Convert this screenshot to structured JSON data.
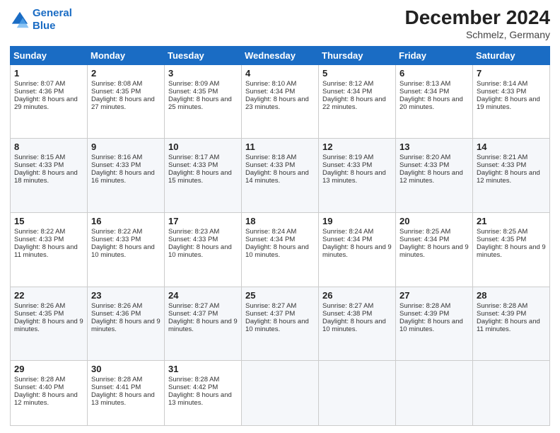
{
  "header": {
    "logo_line1": "General",
    "logo_line2": "Blue",
    "month": "December 2024",
    "location": "Schmelz, Germany"
  },
  "days_of_week": [
    "Sunday",
    "Monday",
    "Tuesday",
    "Wednesday",
    "Thursday",
    "Friday",
    "Saturday"
  ],
  "weeks": [
    [
      {
        "day": "1",
        "sunrise": "Sunrise: 8:07 AM",
        "sunset": "Sunset: 4:36 PM",
        "daylight": "Daylight: 8 hours and 29 minutes."
      },
      {
        "day": "2",
        "sunrise": "Sunrise: 8:08 AM",
        "sunset": "Sunset: 4:35 PM",
        "daylight": "Daylight: 8 hours and 27 minutes."
      },
      {
        "day": "3",
        "sunrise": "Sunrise: 8:09 AM",
        "sunset": "Sunset: 4:35 PM",
        "daylight": "Daylight: 8 hours and 25 minutes."
      },
      {
        "day": "4",
        "sunrise": "Sunrise: 8:10 AM",
        "sunset": "Sunset: 4:34 PM",
        "daylight": "Daylight: 8 hours and 23 minutes."
      },
      {
        "day": "5",
        "sunrise": "Sunrise: 8:12 AM",
        "sunset": "Sunset: 4:34 PM",
        "daylight": "Daylight: 8 hours and 22 minutes."
      },
      {
        "day": "6",
        "sunrise": "Sunrise: 8:13 AM",
        "sunset": "Sunset: 4:34 PM",
        "daylight": "Daylight: 8 hours and 20 minutes."
      },
      {
        "day": "7",
        "sunrise": "Sunrise: 8:14 AM",
        "sunset": "Sunset: 4:33 PM",
        "daylight": "Daylight: 8 hours and 19 minutes."
      }
    ],
    [
      {
        "day": "8",
        "sunrise": "Sunrise: 8:15 AM",
        "sunset": "Sunset: 4:33 PM",
        "daylight": "Daylight: 8 hours and 18 minutes."
      },
      {
        "day": "9",
        "sunrise": "Sunrise: 8:16 AM",
        "sunset": "Sunset: 4:33 PM",
        "daylight": "Daylight: 8 hours and 16 minutes."
      },
      {
        "day": "10",
        "sunrise": "Sunrise: 8:17 AM",
        "sunset": "Sunset: 4:33 PM",
        "daylight": "Daylight: 8 hours and 15 minutes."
      },
      {
        "day": "11",
        "sunrise": "Sunrise: 8:18 AM",
        "sunset": "Sunset: 4:33 PM",
        "daylight": "Daylight: 8 hours and 14 minutes."
      },
      {
        "day": "12",
        "sunrise": "Sunrise: 8:19 AM",
        "sunset": "Sunset: 4:33 PM",
        "daylight": "Daylight: 8 hours and 13 minutes."
      },
      {
        "day": "13",
        "sunrise": "Sunrise: 8:20 AM",
        "sunset": "Sunset: 4:33 PM",
        "daylight": "Daylight: 8 hours and 12 minutes."
      },
      {
        "day": "14",
        "sunrise": "Sunrise: 8:21 AM",
        "sunset": "Sunset: 4:33 PM",
        "daylight": "Daylight: 8 hours and 12 minutes."
      }
    ],
    [
      {
        "day": "15",
        "sunrise": "Sunrise: 8:22 AM",
        "sunset": "Sunset: 4:33 PM",
        "daylight": "Daylight: 8 hours and 11 minutes."
      },
      {
        "day": "16",
        "sunrise": "Sunrise: 8:22 AM",
        "sunset": "Sunset: 4:33 PM",
        "daylight": "Daylight: 8 hours and 10 minutes."
      },
      {
        "day": "17",
        "sunrise": "Sunrise: 8:23 AM",
        "sunset": "Sunset: 4:33 PM",
        "daylight": "Daylight: 8 hours and 10 minutes."
      },
      {
        "day": "18",
        "sunrise": "Sunrise: 8:24 AM",
        "sunset": "Sunset: 4:34 PM",
        "daylight": "Daylight: 8 hours and 10 minutes."
      },
      {
        "day": "19",
        "sunrise": "Sunrise: 8:24 AM",
        "sunset": "Sunset: 4:34 PM",
        "daylight": "Daylight: 8 hours and 9 minutes."
      },
      {
        "day": "20",
        "sunrise": "Sunrise: 8:25 AM",
        "sunset": "Sunset: 4:34 PM",
        "daylight": "Daylight: 8 hours and 9 minutes."
      },
      {
        "day": "21",
        "sunrise": "Sunrise: 8:25 AM",
        "sunset": "Sunset: 4:35 PM",
        "daylight": "Daylight: 8 hours and 9 minutes."
      }
    ],
    [
      {
        "day": "22",
        "sunrise": "Sunrise: 8:26 AM",
        "sunset": "Sunset: 4:35 PM",
        "daylight": "Daylight: 8 hours and 9 minutes."
      },
      {
        "day": "23",
        "sunrise": "Sunrise: 8:26 AM",
        "sunset": "Sunset: 4:36 PM",
        "daylight": "Daylight: 8 hours and 9 minutes."
      },
      {
        "day": "24",
        "sunrise": "Sunrise: 8:27 AM",
        "sunset": "Sunset: 4:37 PM",
        "daylight": "Daylight: 8 hours and 9 minutes."
      },
      {
        "day": "25",
        "sunrise": "Sunrise: 8:27 AM",
        "sunset": "Sunset: 4:37 PM",
        "daylight": "Daylight: 8 hours and 10 minutes."
      },
      {
        "day": "26",
        "sunrise": "Sunrise: 8:27 AM",
        "sunset": "Sunset: 4:38 PM",
        "daylight": "Daylight: 8 hours and 10 minutes."
      },
      {
        "day": "27",
        "sunrise": "Sunrise: 8:28 AM",
        "sunset": "Sunset: 4:39 PM",
        "daylight": "Daylight: 8 hours and 10 minutes."
      },
      {
        "day": "28",
        "sunrise": "Sunrise: 8:28 AM",
        "sunset": "Sunset: 4:39 PM",
        "daylight": "Daylight: 8 hours and 11 minutes."
      }
    ],
    [
      {
        "day": "29",
        "sunrise": "Sunrise: 8:28 AM",
        "sunset": "Sunset: 4:40 PM",
        "daylight": "Daylight: 8 hours and 12 minutes."
      },
      {
        "day": "30",
        "sunrise": "Sunrise: 8:28 AM",
        "sunset": "Sunset: 4:41 PM",
        "daylight": "Daylight: 8 hours and 13 minutes."
      },
      {
        "day": "31",
        "sunrise": "Sunrise: 8:28 AM",
        "sunset": "Sunset: 4:42 PM",
        "daylight": "Daylight: 8 hours and 13 minutes."
      },
      null,
      null,
      null,
      null
    ]
  ]
}
